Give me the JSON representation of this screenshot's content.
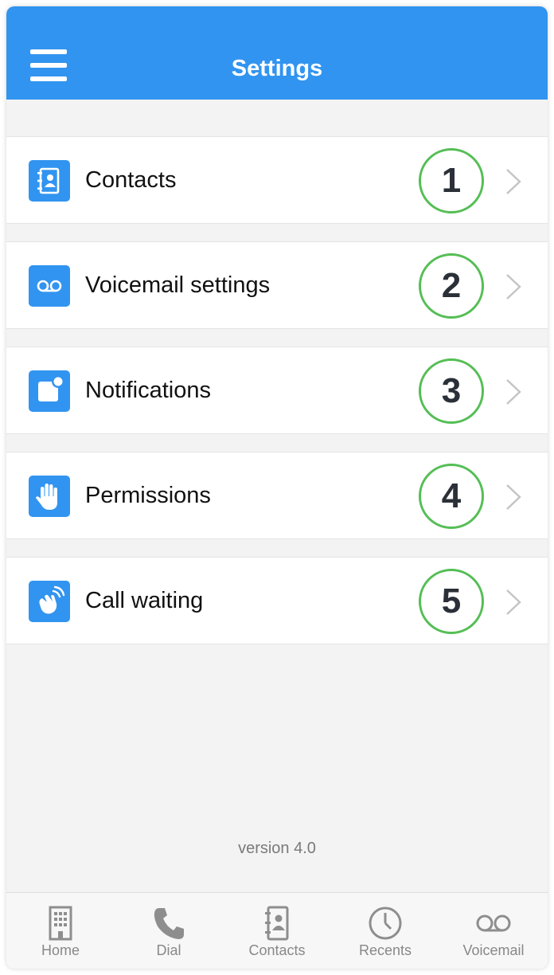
{
  "header": {
    "title": "Settings",
    "menu_icon": "hamburger-menu-icon",
    "background": "#3194f0"
  },
  "menu": [
    {
      "label": "Contacts",
      "icon": "address-book-icon",
      "badge": "1"
    },
    {
      "label": "Voicemail settings",
      "icon": "voicemail-icon",
      "badge": "2"
    },
    {
      "label": "Notifications",
      "icon": "notification-badge-icon",
      "badge": "3"
    },
    {
      "label": "Permissions",
      "icon": "hand-icon",
      "badge": "4"
    },
    {
      "label": "Call waiting",
      "icon": "waving-hand-icon",
      "badge": "5"
    }
  ],
  "colors": {
    "accent": "#3194f0",
    "badge_border": "#55be55",
    "chevron": "#c4c4c4"
  },
  "footer": {
    "version": "version 4.0"
  },
  "tabbar": [
    {
      "label": "Home",
      "icon": "building-icon"
    },
    {
      "label": "Dial",
      "icon": "phone-icon"
    },
    {
      "label": "Contacts",
      "icon": "address-book-icon"
    },
    {
      "label": "Recents",
      "icon": "clock-icon"
    },
    {
      "label": "Voicemail",
      "icon": "voicemail-icon"
    }
  ]
}
